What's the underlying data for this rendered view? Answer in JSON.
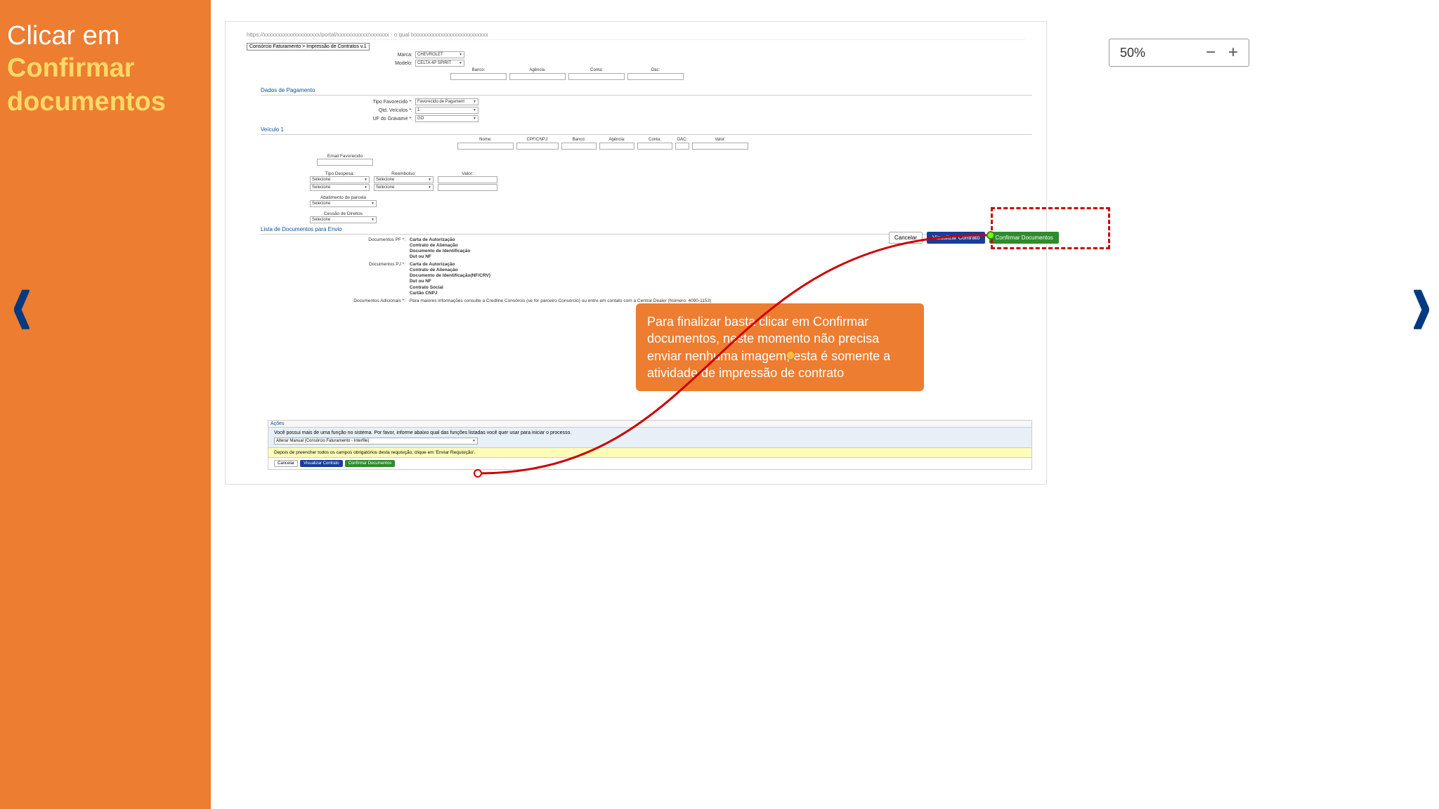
{
  "instruction": {
    "line1": "Clicar em",
    "line2a": "Confirmar",
    "line2b": "documentos"
  },
  "url_hint": "https://xxxxxxxxxxxxxxxxxxxx/portal/xxxxxxxxxxx/xxxxxxx · o qual lxxxxxxxxxxxxxxxxxxxxxxxxxxx",
  "breadcrumb": "Consórcio Faturamento > Impressão de Contratos v.1",
  "vehicle": {
    "marca_label": "Marca:",
    "marca_value": "CHEVROLET",
    "modelo_label": "Modelo:",
    "modelo_value": "CELTA 4P SPIRIT"
  },
  "bank1": {
    "banco": "Banco:",
    "agencia": "Agência:",
    "conta": "Conta:",
    "dac": "Dac:"
  },
  "sections": {
    "dados_pag": "Dados de Pagamento",
    "veiculo1": "Veículo 1",
    "lista_docs": "Lista de Documentos para Envio"
  },
  "pag": {
    "tipo_fav_label": "Tipo Favorecido *:",
    "tipo_fav_value": "Favorecido de Pagament",
    "qtd_label": "Qtd. Veículos *:",
    "qtd_value": "1",
    "uf_label": "UF do Gravame *:",
    "uf_value": "GO"
  },
  "bank2": {
    "nome": "Nome:",
    "cpf": "CPF/CNPJ:",
    "banco": "Banco:",
    "agencia": "Agência:",
    "conta": "Conta:",
    "dac": "DAC:",
    "valor": "Valor:"
  },
  "email_fav": "Email Favorecido",
  "despesa": {
    "tipo": "Tipo Despesa:",
    "reembolso": "Reembolso:",
    "valor": "Valor:",
    "sel": "Selecione"
  },
  "abatimento": {
    "label": "Abatimento de parcela",
    "sel": "Selecione"
  },
  "cessao": {
    "label": "Cessão de Direitos",
    "sel": "Selecione"
  },
  "docs": {
    "pf_label": "Documentos PF *:",
    "pf": [
      "Carta de Autorização",
      "Contrato de Alienação",
      "Documento de Identificação",
      "Dut ou NF"
    ],
    "pj_label": "Documentos PJ *:",
    "pj": [
      "Carta de Autorização",
      "Contrato de Alienação",
      "Documento de Identificação(NF/CRV)",
      "Dut ou NF",
      "Contrato Social",
      "Cartão CNPJ"
    ],
    "adic_label": "Documentos Adicionais *:",
    "adic": "Para maiores informações consulte a Credline Consórcio (se for parceiro Consórcio) ou entre em contato com a Central Dealer (Número: 4090-1153)"
  },
  "buttons": {
    "cancelar": "Cancelar",
    "visualizar": "Visualizar Contrato",
    "confirmar": "Confirmar Documentos"
  },
  "callout": "Para finalizar basta clicar em Confirmar documentos, neste momento não precisa enviar nenhuma imagem, esta é somente a atividade de impressão de contrato",
  "zoom": {
    "value": "50%",
    "minus": "−",
    "plus": "+"
  },
  "acoes": {
    "head": "Ações",
    "body": "Você possui mais de uma função no sistema. Por favor, informe abaixo qual das funções listadas você quer usar para iniciar o processo.",
    "select": "Alterar Manual (Consórcio Faturamento - Interfile)",
    "warn": "Depois de preencher todos os campos obrigatórios desta requisição, clique em 'Enviar Requisição'.",
    "btn1": "Cancelar",
    "btn2": "Visualizar Contrato",
    "btn3": "Confirmar Documentos"
  }
}
